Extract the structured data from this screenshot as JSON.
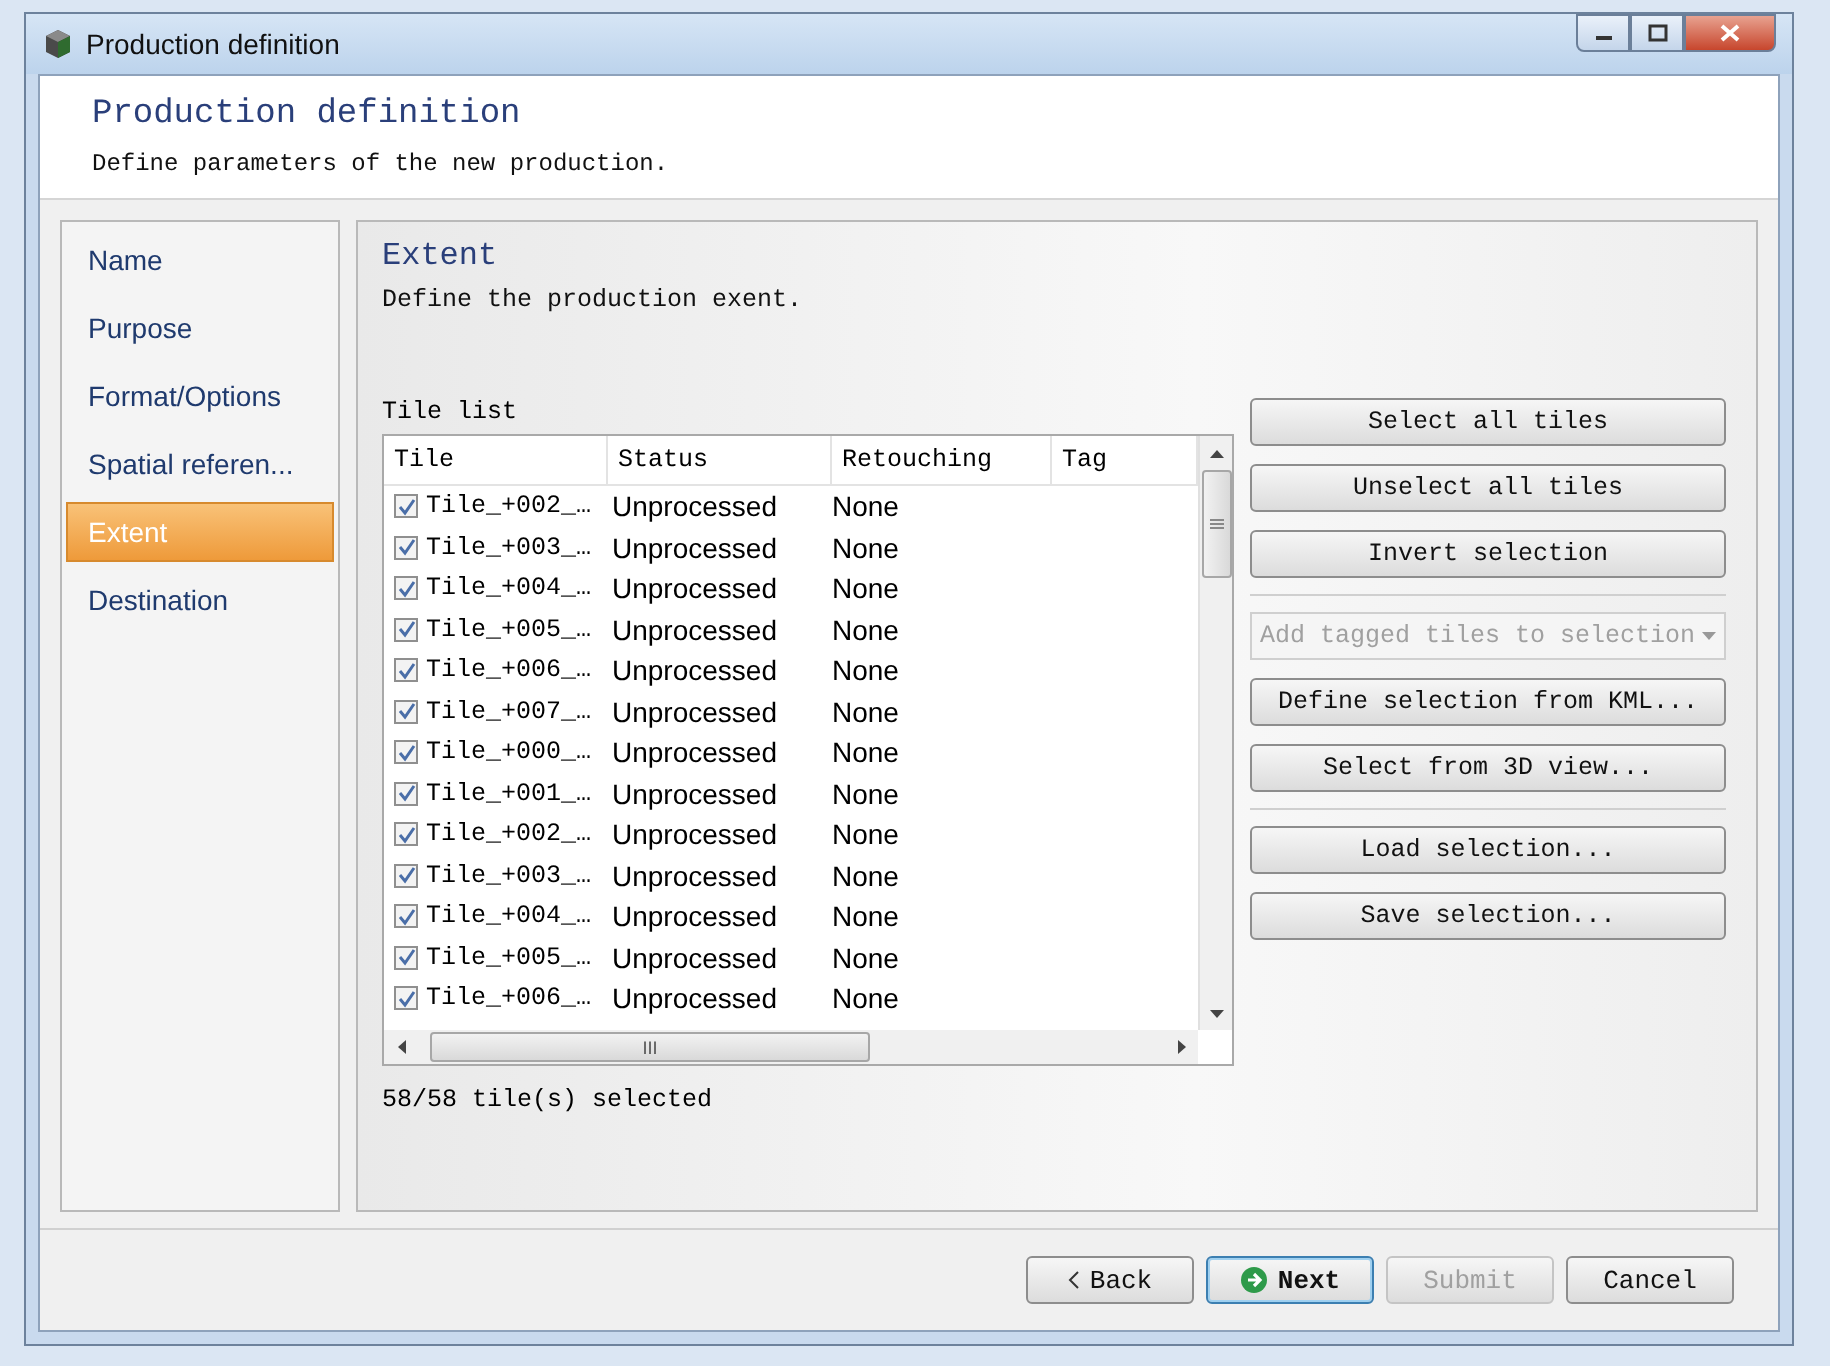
{
  "window": {
    "title": "Production definition"
  },
  "header": {
    "title": "Production definition",
    "subtitle": "Define parameters of the new production."
  },
  "steps": [
    {
      "label": "Name",
      "selected": false
    },
    {
      "label": "Purpose",
      "selected": false
    },
    {
      "label": "Format/Options",
      "selected": false
    },
    {
      "label": "Spatial referen...",
      "selected": false
    },
    {
      "label": "Extent",
      "selected": true
    },
    {
      "label": "Destination",
      "selected": false
    }
  ],
  "panel": {
    "title": "Extent",
    "subtitle": "Define the production exent."
  },
  "tile_list": {
    "label": "Tile list",
    "columns": [
      "Tile",
      "Status",
      "Retouching",
      "Tag"
    ],
    "rows": [
      {
        "tile": "Tile_+002_…",
        "status": "Unprocessed",
        "retouching": "None",
        "checked": true
      },
      {
        "tile": "Tile_+003_…",
        "status": "Unprocessed",
        "retouching": "None",
        "checked": true
      },
      {
        "tile": "Tile_+004_…",
        "status": "Unprocessed",
        "retouching": "None",
        "checked": true
      },
      {
        "tile": "Tile_+005_…",
        "status": "Unprocessed",
        "retouching": "None",
        "checked": true
      },
      {
        "tile": "Tile_+006_…",
        "status": "Unprocessed",
        "retouching": "None",
        "checked": true
      },
      {
        "tile": "Tile_+007_…",
        "status": "Unprocessed",
        "retouching": "None",
        "checked": true
      },
      {
        "tile": "Tile_+000_…",
        "status": "Unprocessed",
        "retouching": "None",
        "checked": true
      },
      {
        "tile": "Tile_+001_…",
        "status": "Unprocessed",
        "retouching": "None",
        "checked": true
      },
      {
        "tile": "Tile_+002_…",
        "status": "Unprocessed",
        "retouching": "None",
        "checked": true
      },
      {
        "tile": "Tile_+003_…",
        "status": "Unprocessed",
        "retouching": "None",
        "checked": true
      },
      {
        "tile": "Tile_+004_…",
        "status": "Unprocessed",
        "retouching": "None",
        "checked": true
      },
      {
        "tile": "Tile_+005_…",
        "status": "Unprocessed",
        "retouching": "None",
        "checked": true
      },
      {
        "tile": "Tile_+006_…",
        "status": "Unprocessed",
        "retouching": "None",
        "checked": true
      }
    ],
    "horizontal_scroll_grip": "III",
    "summary": "58/58 tile(s) selected"
  },
  "action_groups": [
    [
      {
        "kind": "button",
        "label": "Select all tiles",
        "disabled": false
      },
      {
        "kind": "button",
        "label": "Unselect all tiles",
        "disabled": false
      },
      {
        "kind": "button",
        "label": "Invert selection",
        "disabled": false
      }
    ],
    [
      {
        "kind": "dropdown",
        "label": "Add tagged tiles to selection",
        "disabled": true
      },
      {
        "kind": "button",
        "label": "Define selection from KML...",
        "disabled": false
      },
      {
        "kind": "button",
        "label": "Select from 3D view...",
        "disabled": false
      }
    ],
    [
      {
        "kind": "button",
        "label": "Load selection...",
        "disabled": false
      },
      {
        "kind": "button",
        "label": "Save selection...",
        "disabled": false
      }
    ]
  ],
  "footer_buttons": [
    {
      "kind": "back",
      "label": "Back",
      "disabled": false
    },
    {
      "kind": "next",
      "label": "Next",
      "disabled": false
    },
    {
      "kind": "plain",
      "label": "Submit",
      "disabled": true
    },
    {
      "kind": "plain",
      "label": "Cancel",
      "disabled": false
    }
  ]
}
